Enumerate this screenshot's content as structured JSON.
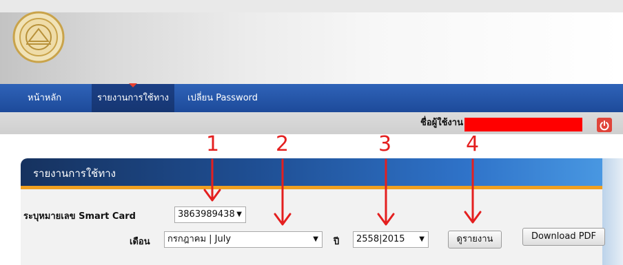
{
  "nav": {
    "items": [
      {
        "label": "หน้าหลัก"
      },
      {
        "label": "รายงานการใช้ทาง"
      },
      {
        "label": "เปลี่ยน Password"
      }
    ]
  },
  "userbar": {
    "user_label": "ชื่อผู้ใช้งาน"
  },
  "panel": {
    "title": "รายงานการใช้ทาง",
    "smartcard_label": "ระบุหมายเลข Smart Card",
    "smartcard_value": "3863989438",
    "month_label": "เดือน",
    "month_value": "กรกฎาคม | July",
    "year_label": "ปี",
    "year_value": "2558|2015",
    "view_button": "ดูรายงาน",
    "download_button": "Download PDF"
  },
  "annotations": [
    "1",
    "2",
    "3",
    "4"
  ],
  "colors": {
    "nav": "#1d4a9a",
    "accent_red": "#e41f1f",
    "stripe": "#f0a020"
  }
}
